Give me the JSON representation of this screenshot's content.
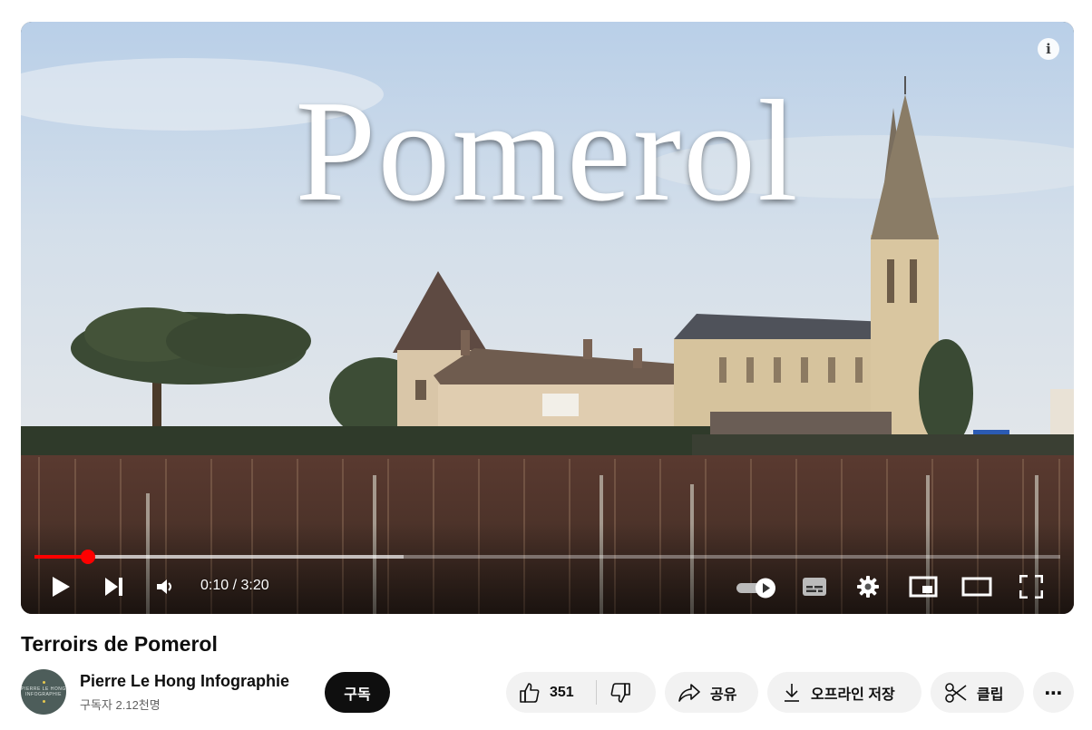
{
  "player": {
    "overlay_title": "Pomerol",
    "info_icon": "i",
    "time_display": "0:10 / 3:20",
    "progress_fraction": 0.052,
    "buffered_fraction": 0.36
  },
  "video": {
    "title": "Terroirs de Pomerol"
  },
  "channel": {
    "name": "Pierre Le Hong Infographie",
    "subscribers": "구독자 2.12천명",
    "avatar_text_1": "PIERRE LE HONG",
    "avatar_text_2": "INFOGRAPHIE"
  },
  "actions": {
    "subscribe_label": "구독",
    "like_count": "351",
    "share_label": "공유",
    "download_label": "오프라인 저장",
    "clip_label": "클립",
    "more_label": "⋯"
  },
  "colors": {
    "progress_played": "#ff0000",
    "subscribe_bg": "#0f0f0f",
    "pill_bg": "#f2f2f2"
  },
  "icons": [
    "info-icon",
    "play-icon",
    "next-icon",
    "volume-icon",
    "autoplay-toggle-icon",
    "subtitles-icon",
    "settings-icon",
    "miniplayer-icon",
    "theater-mode-icon",
    "fullscreen-icon",
    "thumbs-up-icon",
    "thumbs-down-icon",
    "share-icon",
    "download-icon",
    "scissors-icon",
    "more-icon"
  ]
}
